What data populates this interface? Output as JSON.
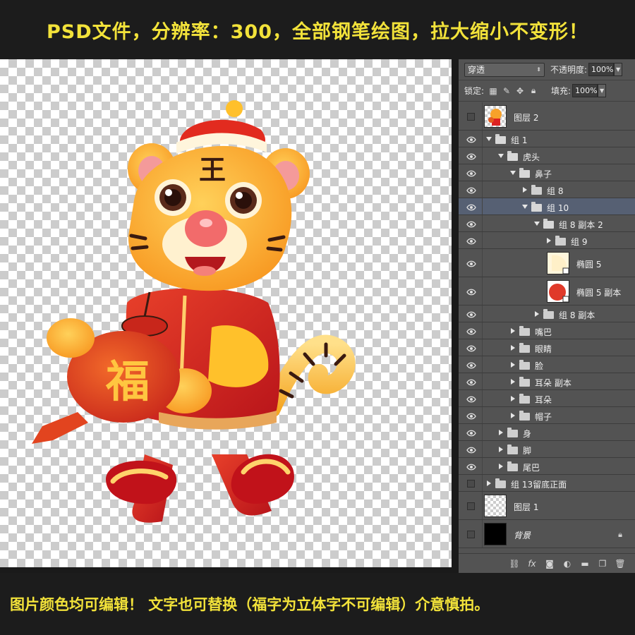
{
  "banners": {
    "top": "PSD文件，分辨率：300，全部钢笔绘图，拉大缩小不变形！",
    "bottom": "图片颜色均可编辑！ 文字也可替换（福字为立体字不可编辑）介意慎拍。"
  },
  "artwork": {
    "forehead_char": "王",
    "lantern_char": "福"
  },
  "layers_panel": {
    "blend_mode": "穿透",
    "opacity_label": "不透明度:",
    "opacity_value": "100%",
    "lock_label": "锁定:",
    "fill_label": "填充:",
    "fill_value": "100%",
    "layers": [
      {
        "name": "图层 2",
        "kind": "thumb-tiger",
        "indent": 0,
        "visible": false
      },
      {
        "name": "组 1",
        "kind": "group-open",
        "indent": 0,
        "visible": true
      },
      {
        "name": "虎头",
        "kind": "group-open",
        "indent": 1,
        "visible": true
      },
      {
        "name": "鼻子",
        "kind": "group-open",
        "indent": 2,
        "visible": true
      },
      {
        "name": "组 8",
        "kind": "group-closed",
        "indent": 3,
        "visible": true
      },
      {
        "name": "组 10",
        "kind": "group-open",
        "indent": 3,
        "visible": true,
        "selected": true
      },
      {
        "name": "组 8 副本 2",
        "kind": "group-open",
        "indent": 4,
        "visible": true
      },
      {
        "name": "组 9",
        "kind": "group-closed",
        "indent": 5,
        "visible": true
      },
      {
        "name": "椭圆 5",
        "kind": "thumb-ellipse-cream",
        "indent": 5,
        "visible": true
      },
      {
        "name": "椭圆 5 副本",
        "kind": "thumb-ellipse-red",
        "indent": 5,
        "visible": true
      },
      {
        "name": "组 8 副本",
        "kind": "group-closed",
        "indent": 4,
        "visible": true
      },
      {
        "name": "嘴巴",
        "kind": "group-closed",
        "indent": 2,
        "visible": true
      },
      {
        "name": "眼睛",
        "kind": "group-closed",
        "indent": 2,
        "visible": true
      },
      {
        "name": "脸",
        "kind": "group-closed",
        "indent": 2,
        "visible": true
      },
      {
        "name": "耳朵 副本",
        "kind": "group-closed",
        "indent": 2,
        "visible": true
      },
      {
        "name": "耳朵",
        "kind": "group-closed",
        "indent": 2,
        "visible": true
      },
      {
        "name": "帽子",
        "kind": "group-closed",
        "indent": 2,
        "visible": true
      },
      {
        "name": "身",
        "kind": "group-closed",
        "indent": 1,
        "visible": true
      },
      {
        "name": "脚",
        "kind": "group-closed",
        "indent": 1,
        "visible": true
      },
      {
        "name": "尾巴",
        "kind": "group-closed",
        "indent": 1,
        "visible": true
      },
      {
        "name": "组 13留底正面",
        "kind": "group-closed",
        "indent": 0,
        "visible": false
      },
      {
        "name": "图层 1",
        "kind": "thumb-checker",
        "indent": 0,
        "visible": false
      },
      {
        "name": "背景",
        "kind": "thumb-black",
        "indent": 0,
        "visible": false,
        "locked": true
      }
    ]
  },
  "colors": {
    "banner_text": "#f2e23a",
    "panel_bg": "#535353",
    "selected_row": "#566073"
  }
}
